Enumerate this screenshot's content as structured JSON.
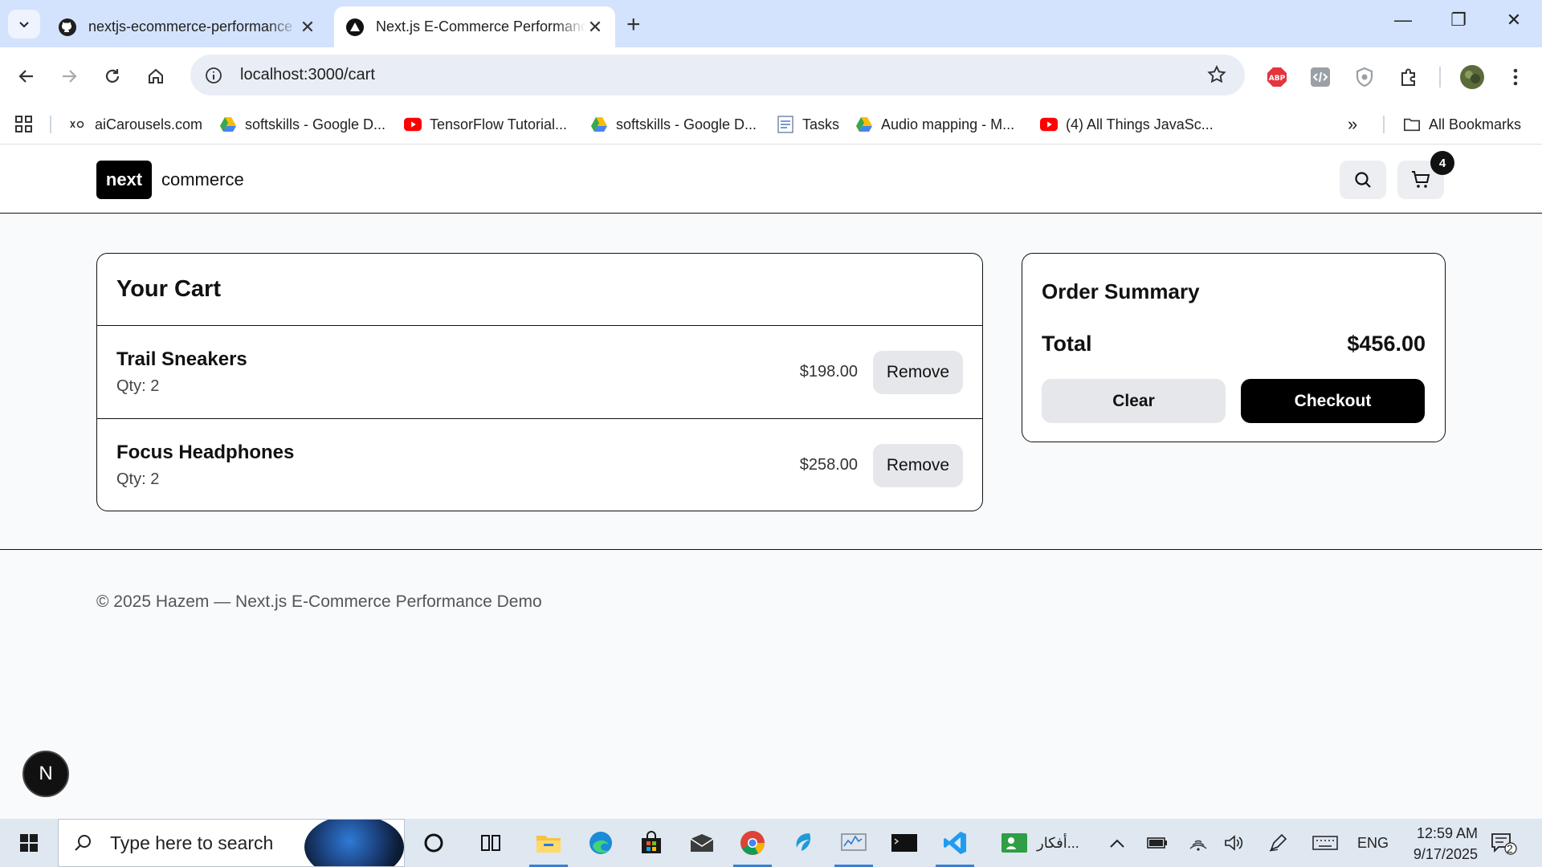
{
  "browser": {
    "tabs": [
      {
        "title": "nextjs-ecommerce-performance",
        "icon": "github-icon",
        "active": false
      },
      {
        "title": "Next.js E-Commerce Performance",
        "icon": "nextjs-icon",
        "active": true
      }
    ],
    "new_tab": "+",
    "url": "localhost:3000/cart",
    "bookmarks": [
      {
        "label": "aiCarousels.com",
        "icon": "aicarousels-icon"
      },
      {
        "label": "softskills - Google D...",
        "icon": "google-drive-icon"
      },
      {
        "label": "TensorFlow Tutorial...",
        "icon": "youtube-icon"
      },
      {
        "label": "softskills - Google D...",
        "icon": "google-drive-icon"
      },
      {
        "label": "Tasks",
        "icon": "tasks-icon"
      },
      {
        "label": "Audio mapping - M...",
        "icon": "google-drive-icon"
      },
      {
        "label": "(4) All Things JavaSc...",
        "icon": "youtube-icon"
      }
    ],
    "all_bookmarks": "All Bookmarks",
    "more": "»"
  },
  "site": {
    "logo_badge": "next",
    "logo_text": "commerce",
    "cart_count": "4"
  },
  "cart": {
    "title": "Your Cart",
    "items": [
      {
        "name": "Trail Sneakers",
        "qty": "Qty: 2",
        "price": "$198.00",
        "remove": "Remove"
      },
      {
        "name": "Focus Headphones",
        "qty": "Qty: 2",
        "price": "$258.00",
        "remove": "Remove"
      }
    ]
  },
  "summary": {
    "title": "Order Summary",
    "total_label": "Total",
    "total_value": "$456.00",
    "clear": "Clear",
    "checkout": "Checkout"
  },
  "footer": {
    "text": "© 2025 Hazem — Next.js E-Commerce Performance Demo"
  },
  "dev_badge": "N",
  "taskbar": {
    "search_placeholder": "Type here to search",
    "arabic_label": "أفكار...",
    "language": "ENG",
    "time": "12:59 AM",
    "date": "9/17/2025",
    "notifications": "2"
  },
  "colors": {
    "tabstrip": "#d3e3fd",
    "page_bg": "#f8fafc",
    "primary": "#000000",
    "secondary_btn": "#e5e7eb"
  }
}
